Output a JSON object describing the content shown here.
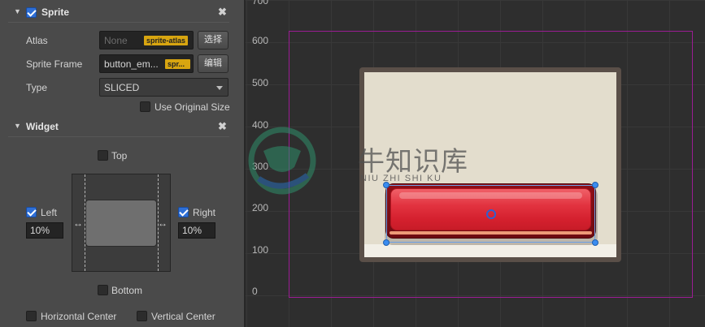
{
  "sprite": {
    "title": "Sprite",
    "enabled": true,
    "atlas_label": "Atlas",
    "atlas_placeholder": "None",
    "atlas_tag": "sprite-atlas",
    "atlas_button": "选择",
    "sprite_frame_label": "Sprite Frame",
    "sprite_frame_value": "button_em...",
    "sprite_frame_tag": "spr...",
    "sprite_frame_button": "编辑",
    "type_label": "Type",
    "type_value": "SLICED",
    "use_original_size_label": "Use Original Size",
    "use_original_size_checked": false
  },
  "widget": {
    "title": "Widget",
    "enabled": true,
    "top_label": "Top",
    "top_checked": false,
    "left_label": "Left",
    "left_checked": true,
    "left_value": "10%",
    "right_label": "Right",
    "right_checked": true,
    "right_value": "10%",
    "bottom_label": "Bottom",
    "bottom_checked": false,
    "horizontal_center_label": "Horizontal Center",
    "horizontal_center_checked": false,
    "vertical_center_label": "Vertical Center",
    "vertical_center_checked": false
  },
  "scene": {
    "axis_labels": [
      "700",
      "600",
      "500",
      "400",
      "300",
      "200",
      "100",
      "0"
    ],
    "canvas_border_color": "#9b1c93",
    "button_color": "#d4202e"
  },
  "watermark": {
    "title": "牛知识库",
    "subtitle": "NIU ZHI SHI KU"
  }
}
